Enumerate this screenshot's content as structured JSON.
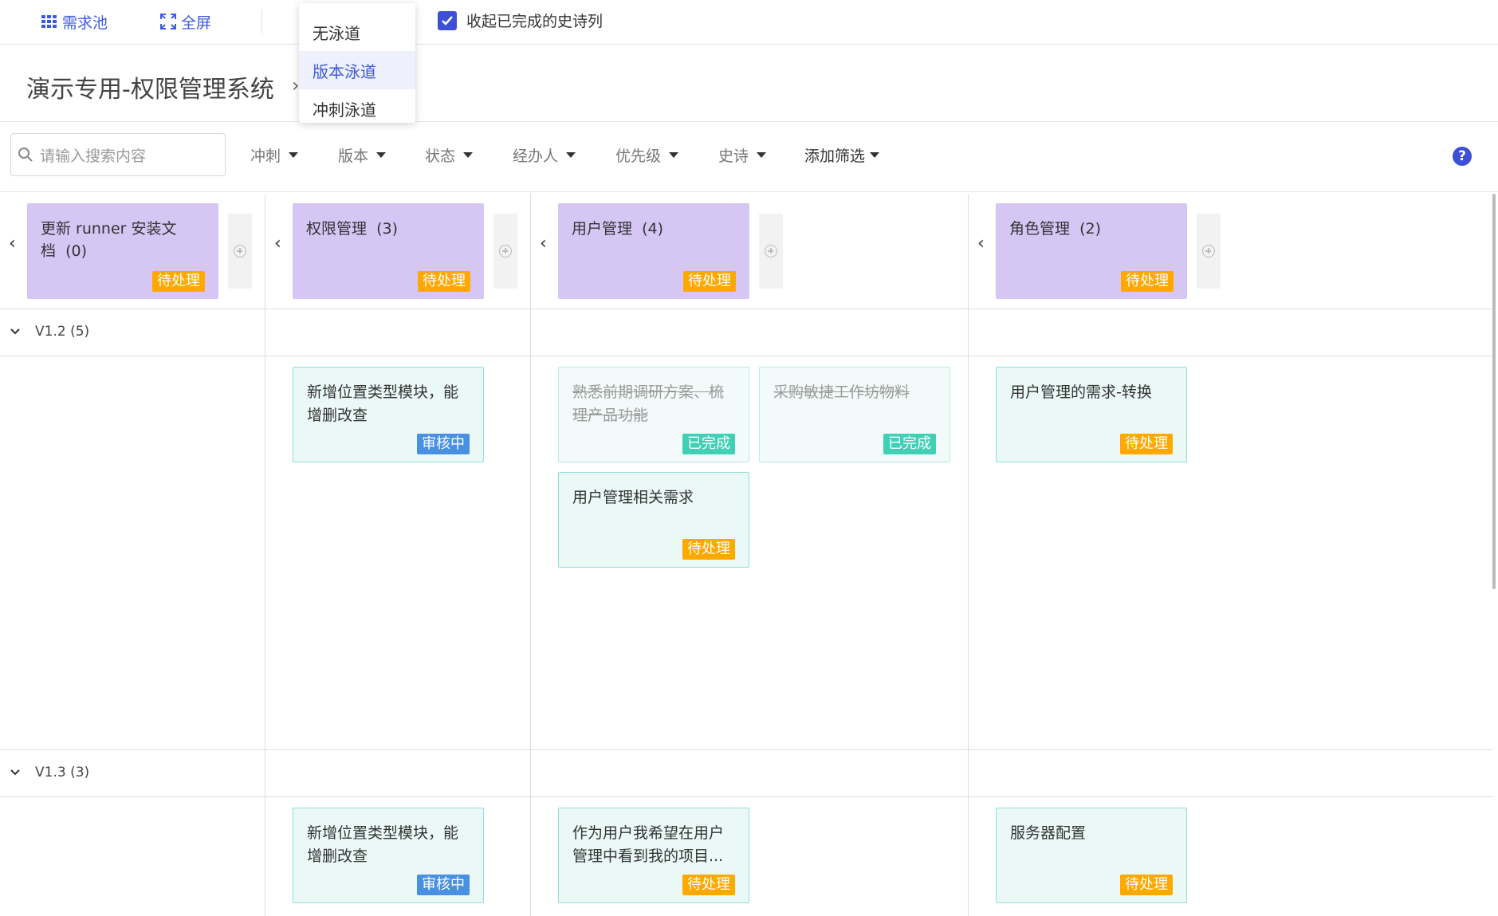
{
  "toolbar": {
    "pool_label": "需求池",
    "fullscreen_label": "全屏",
    "collapse_done_label": "收起已完成的史诗列"
  },
  "swimlane_menu": {
    "items": [
      "无泳道",
      "版本泳道",
      "冲刺泳道"
    ],
    "selected": "版本泳道"
  },
  "page": {
    "title": "演示专用-权限管理系统"
  },
  "filters": {
    "search_placeholder": "请输入搜索内容",
    "sprint": "冲刺",
    "version": "版本",
    "status": "状态",
    "assignee": "经办人",
    "priority": "优先级",
    "epic": "史诗",
    "add_filter": "添加筛选"
  },
  "epics": [
    {
      "name": "更新 runner 安装文档",
      "count": "(0)",
      "status": "待处理"
    },
    {
      "name": "权限管理",
      "count": "(3)",
      "status": "待处理"
    },
    {
      "name": "用户管理",
      "count": "(4)",
      "status": "待处理"
    },
    {
      "name": "角色管理",
      "count": "(2)",
      "status": "待处理"
    }
  ],
  "lanes": [
    {
      "label": "V1.2 (5)",
      "cards": [
        {
          "title": "新增位置类型模块，能增删改查",
          "status": "审核中"
        },
        {
          "title": "熟悉前期调研方案、梳理产品功能",
          "status": "已完成"
        },
        {
          "title": "采购敏捷工作坊物料",
          "status": "已完成"
        },
        {
          "title": "用户管理相关需求",
          "status": "待处理"
        },
        {
          "title": "用户管理的需求-转换",
          "status": "待处理"
        }
      ]
    },
    {
      "label": "V1.3 (3)",
      "cards": [
        {
          "title": "新增位置类型模块，能增删改查",
          "status": "审核中"
        },
        {
          "title": "作为用户我希望在用户管理中看到我的项目...",
          "status": "待处理"
        },
        {
          "title": "服务器配置",
          "status": "待处理"
        }
      ]
    }
  ],
  "colors": {
    "accent": "#3d5bd9",
    "epic_bg": "#d6c6f4",
    "card_bg": "#eaf8f6",
    "pending": "#ffa800",
    "review": "#4a90e2",
    "done": "#3fd0b6"
  }
}
